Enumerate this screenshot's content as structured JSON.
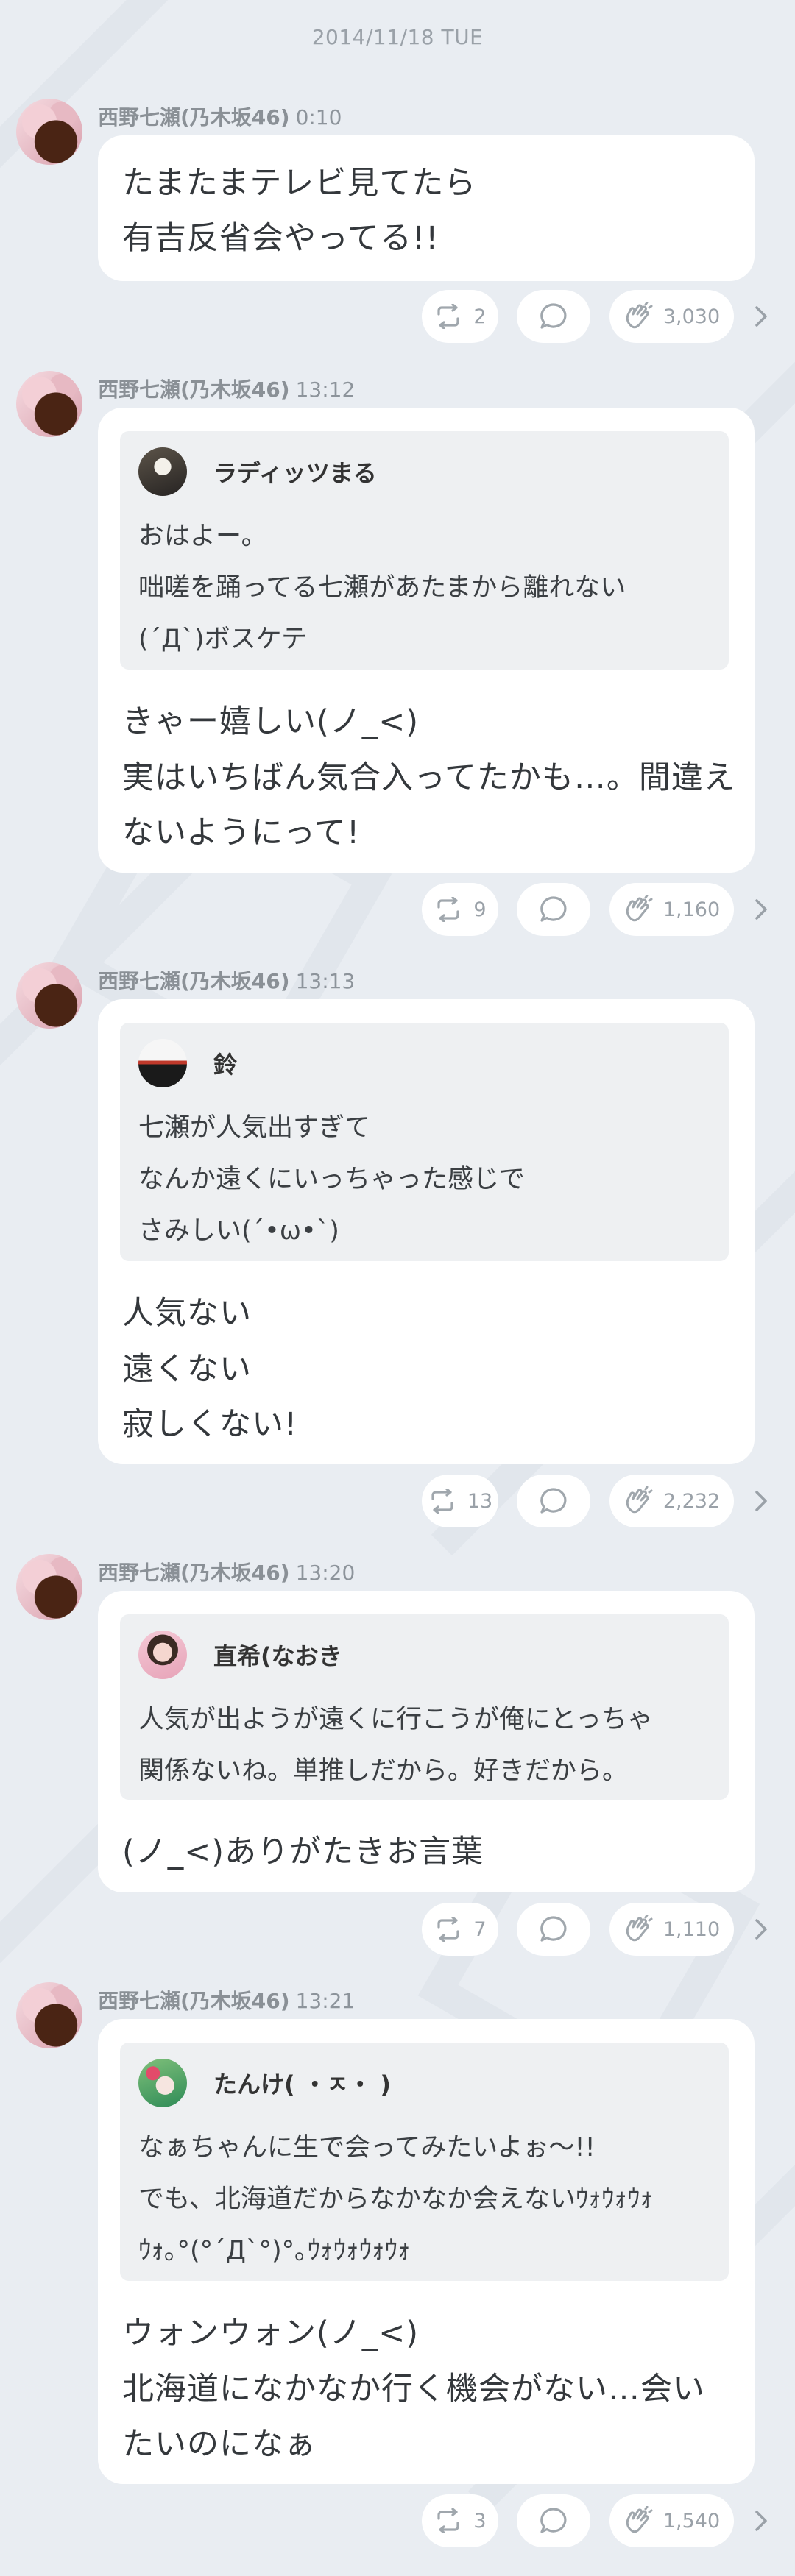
{
  "date_header": "2014/11/18 TUE",
  "posts": [
    {
      "author": "西野七瀬(乃木坂46)",
      "time": "0:10",
      "message_lines": [
        "たまたまテレビ見てたら",
        "有吉反省会やってる!!"
      ],
      "retweets": "2",
      "claps": "3,030"
    },
    {
      "author": "西野七瀬(乃木坂46)",
      "time": "13:12",
      "quote": {
        "name": "ラディッツまる",
        "lines": [
          "おはよー。",
          "咄嗟を踊ってる七瀬があたまから離れない",
          "(´Д`)ボスケテ"
        ]
      },
      "message_lines": [
        "きゃー嬉しい(ノ_<)",
        "実はいちばん気合入ってたかも…。間違え",
        "ないようにって!"
      ],
      "retweets": "9",
      "claps": "1,160"
    },
    {
      "author": "西野七瀬(乃木坂46)",
      "time": "13:13",
      "quote": {
        "name": "鈴",
        "lines": [
          "七瀬が人気出すぎて",
          "なんか遠くにいっちゃった感じで",
          "さみしい(´•ω•`)"
        ]
      },
      "message_lines": [
        "人気ない",
        "遠くない",
        "寂しくない!"
      ],
      "retweets": "13",
      "claps": "2,232"
    },
    {
      "author": "西野七瀬(乃木坂46)",
      "time": "13:20",
      "quote": {
        "name": "直希(なおき",
        "lines": [
          "人気が出ようが遠くに行こうが俺にとっちゃ",
          "関係ないね。単推しだから。好きだから。"
        ]
      },
      "message_lines": [
        "(ノ_<)ありがたきお言葉"
      ],
      "retweets": "7",
      "claps": "1,110"
    },
    {
      "author": "西野七瀬(乃木坂46)",
      "time": "13:21",
      "quote": {
        "name": "たんけ( ・ㅈ・ )",
        "lines": [
          "なぁちゃんに生で会ってみたいよぉ〜!!",
          "でも、北海道だからなかなか会えないｳｫｳｫｳｫ",
          "ｳｫ｡°(°´Д`°)°｡ｳｫｳｫｳｫｳｫ"
        ]
      },
      "message_lines": [
        "ウォンウォン(ノ_<)",
        "北海道になかなか行く機会がない…会い",
        "たいのになぁ"
      ],
      "retweets": "3",
      "claps": "1,540"
    }
  ],
  "icons": {
    "retweet": "retweet-icon",
    "comment": "comment-icon",
    "clap": "clap-icon",
    "more": "chevron-right-icon"
  },
  "colors": {
    "background": "#e9edf2",
    "bubble": "#ffffff",
    "quote_bg": "#eef0f2",
    "meta_text": "#8d949b"
  }
}
